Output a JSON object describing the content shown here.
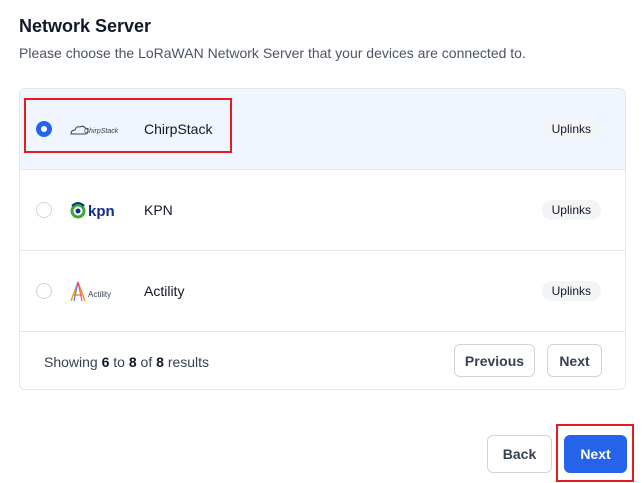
{
  "page": {
    "title": "Network Server",
    "subtitle": "Please choose the LoRaWAN Network Server that your devices are connected to."
  },
  "servers": [
    {
      "name": "ChirpStack",
      "badge": "Uplinks",
      "logo_text": "ChirpStack",
      "logo_icon": "cloud-icon",
      "selected": true
    },
    {
      "name": "KPN",
      "badge": "Uplinks",
      "logo_text": "kpn",
      "logo_icon": "kpn-swirl-icon",
      "selected": false
    },
    {
      "name": "Actility",
      "badge": "Uplinks",
      "logo_text": "Actility",
      "logo_icon": "actility-triangle-icon",
      "selected": false
    }
  ],
  "pagination": {
    "prefix": "Showing",
    "from": "6",
    "to_word": "to",
    "to": "8",
    "of_word": "of",
    "total": "8",
    "suffix": "results",
    "previous_label": "Previous",
    "next_label": "Next"
  },
  "actions": {
    "back_label": "Back",
    "next_label": "Next"
  },
  "colors": {
    "accent": "#2563eb",
    "selected_row": "#eff6ff",
    "highlight": "#e11d1d",
    "kpn_green": "#3aa935",
    "kpn_blue": "#0f2c8c"
  }
}
